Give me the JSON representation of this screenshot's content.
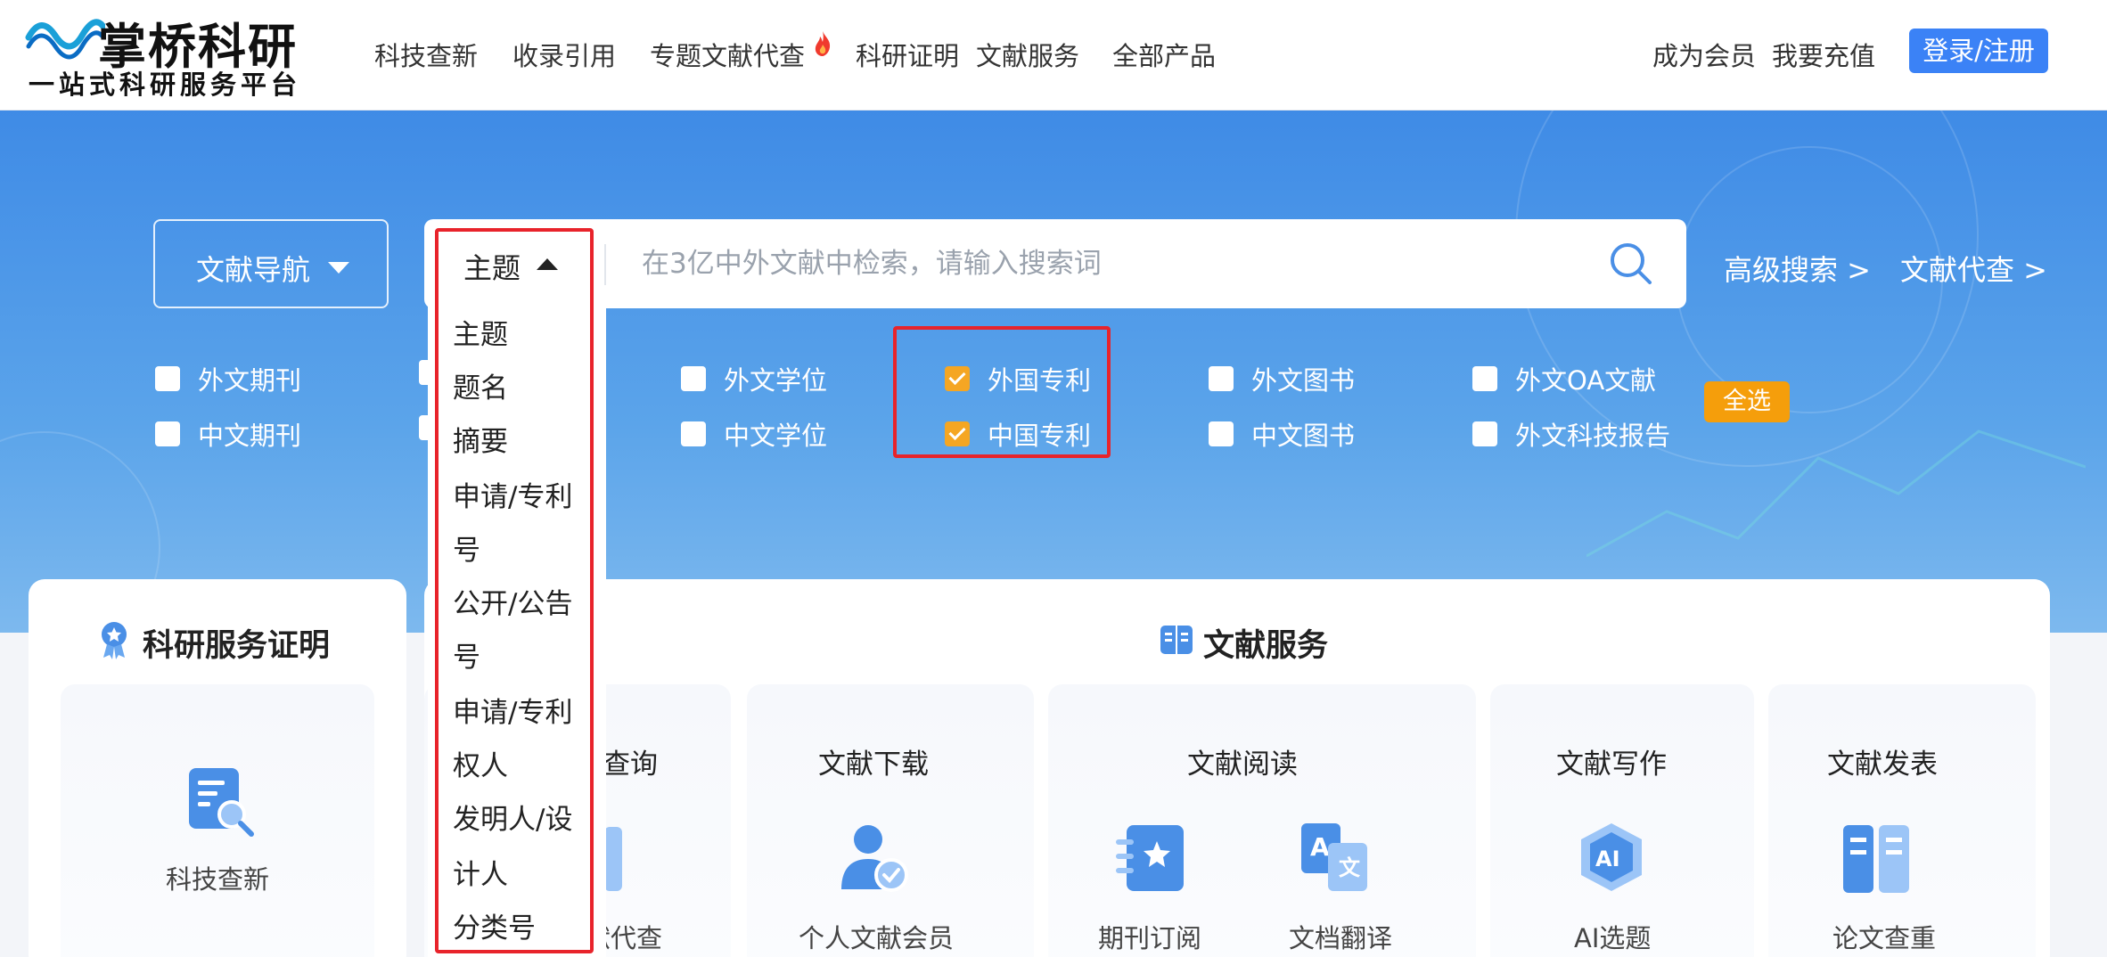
{
  "header": {
    "logo_title": "掌桥科研",
    "logo_subtitle": "一站式科研服务平台",
    "nav": [
      "科技查新",
      "收录引用",
      "专题文献代查",
      "科研证明",
      "文献服务",
      "全部产品"
    ],
    "right_links": [
      "成为会员",
      "我要充值"
    ],
    "login_label": "登录/注册"
  },
  "search": {
    "doc_nav_label": "文献导航",
    "field_selected": "主题",
    "placeholder": "在3亿中外文献中检索，请输入搜索词",
    "links": [
      "高级搜索 >",
      "文献代查 >"
    ]
  },
  "dropdown": {
    "options": [
      "主题",
      "题名",
      "摘要",
      "申请/专利",
      "号",
      "公开/公告",
      "号",
      "申请/专利",
      "权人",
      "发明人/设",
      "计人",
      "分类号"
    ]
  },
  "filters": {
    "row1": [
      {
        "label": "外文期刊",
        "checked": false
      },
      {
        "label": "",
        "checked": false
      },
      {
        "label": "外文学位",
        "checked": false
      },
      {
        "label": "外国专利",
        "checked": true
      },
      {
        "label": "外文图书",
        "checked": false
      },
      {
        "label": "外文OA文献",
        "checked": false
      }
    ],
    "row2": [
      {
        "label": "中文期刊",
        "checked": false
      },
      {
        "label": "",
        "checked": false
      },
      {
        "label": "中文学位",
        "checked": false
      },
      {
        "label": "中国专利",
        "checked": true
      },
      {
        "label": "中文图书",
        "checked": false
      },
      {
        "label": "外文科技报告",
        "checked": false
      }
    ],
    "select_all_label": "全选"
  },
  "left_card": {
    "title": "科研服务证明",
    "item_label": "科技查新"
  },
  "main_card": {
    "title": "文献服务",
    "categories": [
      "查询",
      "文献下载",
      "文献阅读",
      "文献写作",
      "文献发表"
    ],
    "items": [
      "献代查",
      "个人文献会员",
      "期刊订阅",
      "文档翻译",
      "AI选题",
      "论文查重"
    ]
  },
  "colors": {
    "primary": "#3b82f6",
    "banner": "#4a93e8",
    "accent": "#f5a623",
    "highlight_frame": "#e8232b"
  }
}
